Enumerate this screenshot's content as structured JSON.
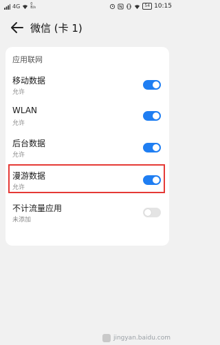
{
  "statusbar": {
    "network": "4G",
    "speed": "0",
    "speed_unit": "B/s",
    "battery": "54",
    "time": "10:15"
  },
  "header": {
    "title": "微信 (卡 1)"
  },
  "section": {
    "label": "应用联网"
  },
  "rows": [
    {
      "title": "移动数据",
      "subtitle": "允许",
      "toggle": "on"
    },
    {
      "title": "WLAN",
      "subtitle": "允许",
      "toggle": "on"
    },
    {
      "title": "后台数据",
      "subtitle": "允许",
      "toggle": "on"
    },
    {
      "title": "漫游数据",
      "subtitle": "允许",
      "toggle": "on"
    },
    {
      "title": "不计流量应用",
      "subtitle": "未添加",
      "toggle": "off"
    }
  ],
  "watermark": {
    "text": "jingyan.baidu.com"
  },
  "colors": {
    "accent": "#1f7ef2",
    "highlight": "#e53935",
    "background": "#f1f1f1"
  }
}
